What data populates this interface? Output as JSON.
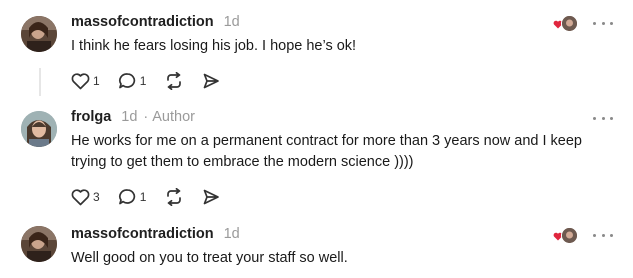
{
  "comments": [
    {
      "username": "massofcontradiction",
      "time": "1d",
      "role": "",
      "text": "I think he fears losing his job. I hope he’s ok!",
      "likes": "1",
      "replies": "1",
      "liked_by_author": true
    },
    {
      "username": "frolga",
      "time": "1d",
      "role": "Author",
      "separator": "·",
      "text": "He works for me on a permanent contract for more than 3 years now and I keep trying to get them to embrace the modern science ))))",
      "likes": "3",
      "replies": "1",
      "liked_by_author": false
    },
    {
      "username": "massofcontradiction",
      "time": "1d",
      "role": "",
      "text": "Well good on you to treat your staff so well.",
      "liked_by_author": true
    }
  ],
  "icons": {
    "like": "heart-outline-icon",
    "reply": "speech-bubble-icon",
    "restack": "restack-arrows-icon",
    "share": "send-arrow-icon",
    "more": "ellipsis-icon",
    "author_liked": "red-heart-icon"
  },
  "colors": {
    "heart_red": "#e0263e",
    "muted": "#9a9a9a",
    "text": "#1a1a1a"
  }
}
